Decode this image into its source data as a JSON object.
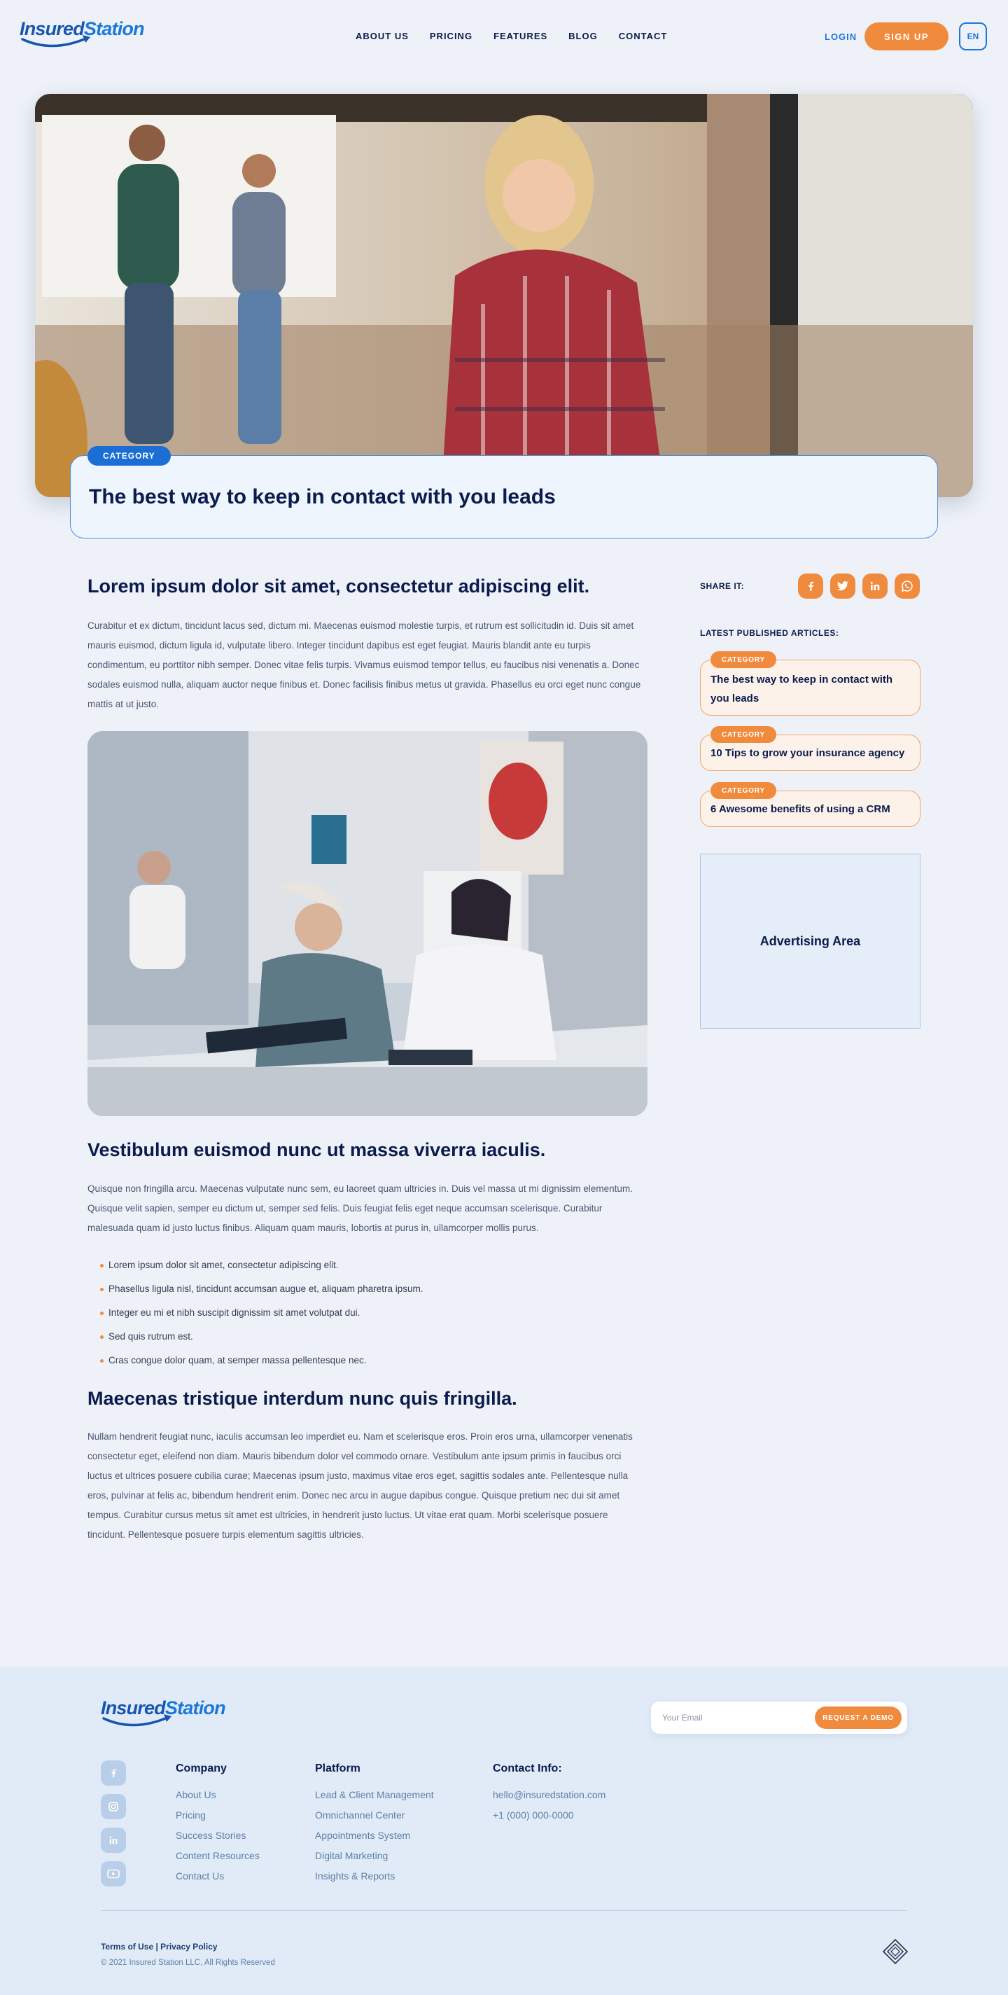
{
  "brand": {
    "name_a": "Insured",
    "name_b": "Station"
  },
  "nav": [
    "ABOUT US",
    "PRICING",
    "FEATURES",
    "BLOG",
    "CONTACT"
  ],
  "header_actions": {
    "login": "LOGIN",
    "signup": "SIGN UP",
    "lang": "EN"
  },
  "hero": {
    "badge": "CATEGORY",
    "title": "The best way to keep in contact with you leads"
  },
  "article": {
    "heading1": "Lorem ipsum dolor sit amet, consectetur adipiscing elit.",
    "para1": "Curabitur et ex dictum, tincidunt lacus sed, dictum mi. Maecenas euismod molestie turpis, et rutrum est sollicitudin id. Duis sit amet mauris euismod, dictum ligula id, vulputate libero. Integer tincidunt dapibus est eget feugiat. Mauris blandit ante eu turpis condimentum, eu porttitor nibh semper. Donec vitae felis turpis. Vivamus euismod tempor tellus, eu faucibus nisi venenatis a. Donec sodales euismod nulla, aliquam auctor neque finibus et. Donec facilisis finibus metus ut gravida. Phasellus eu orci eget nunc congue mattis at ut justo.",
    "heading2": "Vestibulum euismod nunc ut massa viverra iaculis.",
    "para2": "Quisque non fringilla arcu. Maecenas vulputate nunc sem, eu laoreet quam ultricies in. Duis vel massa ut mi dignissim elementum. Quisque velit sapien, semper eu dictum ut, semper sed felis. Duis feugiat felis eget neque accumsan scelerisque. Curabitur malesuada quam id justo luctus finibus. Aliquam quam mauris, lobortis at purus in, ullamcorper mollis purus.",
    "bullets": [
      "Lorem ipsum dolor sit amet, consectetur adipiscing elit.",
      "Phasellus ligula nisl, tincidunt accumsan augue et, aliquam pharetra ipsum.",
      "Integer eu mi et nibh suscipit dignissim sit amet volutpat dui.",
      "Sed quis rutrum est.",
      "Cras congue dolor quam, at semper massa pellentesque nec."
    ],
    "heading3": "Maecenas tristique interdum nunc quis fringilla.",
    "para3": "Nullam hendrerit feugiat nunc, iaculis accumsan leo imperdiet eu. Nam et scelerisque eros. Proin eros urna, ullamcorper venenatis consectetur eget, eleifend non diam. Mauris bibendum dolor vel commodo ornare. Vestibulum ante ipsum primis in faucibus orci luctus et ultrices posuere cubilia curae; Maecenas ipsum justo, maximus vitae eros eget, sagittis sodales ante. Pellentesque nulla eros, pulvinar at felis ac, bibendum hendrerit enim. Donec nec arcu in augue dapibus congue. Quisque pretium nec dui sit amet tempus. Curabitur cursus metus sit amet est ultricies, in hendrerit justo luctus. Ut vitae erat quam. Morbi scelerisque posuere tincidunt. Pellentesque posuere turpis elementum sagittis ultricies."
  },
  "sidebar": {
    "share_label": "SHARE IT:",
    "share_icons": [
      "facebook-icon",
      "twitter-icon",
      "linkedin-icon",
      "whatsapp-icon"
    ],
    "latest_label": "LATEST PUBLISHED ARTICLES:",
    "latest": [
      {
        "tag": "CATEGORY",
        "title": "The best way to keep in contact with you leads"
      },
      {
        "tag": "CATEGORY",
        "title": "10 Tips to grow your insurance agency"
      },
      {
        "tag": "CATEGORY",
        "title": "6 Awesome benefits of using a CRM"
      }
    ],
    "ad": "Advertising Area"
  },
  "footer": {
    "email_placeholder": "Your Email",
    "demo_button": "REQUEST A DEMO",
    "social_icons": [
      "facebook-icon",
      "instagram-icon",
      "linkedin-icon",
      "youtube-icon"
    ],
    "company": {
      "title": "Company",
      "links": [
        "About Us",
        "Pricing",
        "Success Stories",
        "Content Resources",
        "Contact Us"
      ]
    },
    "platform": {
      "title": "Platform",
      "links": [
        "Lead & Client Management",
        "Omnichannel Center",
        "Appointments System",
        "Digital Marketing",
        "Insights & Reports"
      ]
    },
    "contact": {
      "title": "Contact Info:",
      "items": [
        "hello@insuredstation.com",
        "+1 (000) 000-0000"
      ]
    },
    "legal": "Terms of Use | Privacy Policy",
    "copyright": "© 2021 Insured Station LLC, All Rights Reserved"
  },
  "colors": {
    "primary": "#1b6fd4",
    "accent": "#f08b3e",
    "navy": "#0b1b4d",
    "background": "#eef2f8"
  }
}
